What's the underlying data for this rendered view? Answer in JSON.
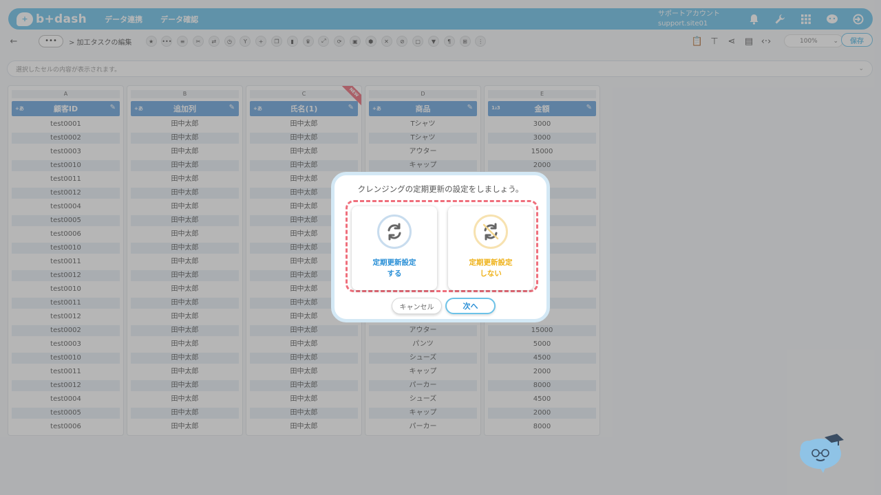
{
  "nav": {
    "logo_text": "b+dash",
    "links": [
      "データ連携",
      "データ確認"
    ],
    "account_line1": "サポートアカウント",
    "account_line2": "support.site01"
  },
  "toolbar": {
    "more_label": "•••",
    "breadcrumb": "> 加工タスクの編集",
    "zoom": "100%",
    "save_label": "保存"
  },
  "formula_bar": {
    "text": "選択したセルの内容が表示されます。"
  },
  "grid": {
    "columns": [
      {
        "letter": "A",
        "type": "+あ",
        "name": "顧客ID",
        "is_new": false
      },
      {
        "letter": "B",
        "type": "+あ",
        "name": "追加列",
        "is_new": false
      },
      {
        "letter": "C",
        "type": "+あ",
        "name": "氏名(1)",
        "is_new": true,
        "badge": "NEW"
      },
      {
        "letter": "D",
        "type": "+あ",
        "name": "商品",
        "is_new": false
      },
      {
        "letter": "E",
        "type": "1₂3",
        "name": "金額",
        "is_new": false
      }
    ],
    "col_a": [
      "test0001",
      "test0002",
      "test0003",
      "test0010",
      "test0011",
      "test0012",
      "test0004",
      "test0005",
      "test0006",
      "test0010",
      "test0011",
      "test0012",
      "test0010",
      "test0011",
      "test0012",
      "test0002",
      "test0003",
      "test0010",
      "test0011",
      "test0012",
      "test0004",
      "test0005",
      "test0006"
    ],
    "col_b": [
      "田中太郎",
      "田中太郎",
      "田中太郎",
      "田中太郎",
      "田中太郎",
      "田中太郎",
      "田中太郎",
      "田中太郎",
      "田中太郎",
      "田中太郎",
      "田中太郎",
      "田中太郎",
      "田中太郎",
      "田中太郎",
      "田中太郎",
      "田中太郎",
      "田中太郎",
      "田中太郎",
      "田中太郎",
      "田中太郎",
      "田中太郎",
      "田中太郎",
      "田中太郎"
    ],
    "col_c": [
      "田中太郎",
      "田中太郎",
      "田中太郎",
      "田中太郎",
      "田中太郎",
      "田中太郎",
      "田中太郎",
      "田中太郎",
      "田中太郎",
      "田中太郎",
      "田中太郎",
      "田中太郎",
      "田中太郎",
      "田中太郎",
      "田中太郎",
      "田中太郎",
      "田中太郎",
      "田中太郎",
      "田中太郎",
      "田中太郎",
      "田中太郎",
      "田中太郎",
      "田中太郎"
    ],
    "col_d": [
      "Tシャツ",
      "Tシャツ",
      "アウター",
      "キャップ",
      "",
      "",
      "",
      "",
      "",
      "",
      "",
      "",
      "",
      "",
      "",
      "アウター",
      "パンツ",
      "シューズ",
      "キャップ",
      "パーカー",
      "シューズ",
      "キャップ",
      "パーカー"
    ],
    "col_e": [
      "3000",
      "3000",
      "15000",
      "2000",
      "",
      "",
      "",
      "",
      "",
      "",
      "",
      "",
      "",
      "",
      "",
      "15000",
      "5000",
      "4500",
      "2000",
      "8000",
      "4500",
      "2000",
      "8000"
    ]
  },
  "modal": {
    "title": "クレンジングの定期更新の設定をしましょう。",
    "option_yes_line1": "定期更新設定",
    "option_yes_line2": "する",
    "option_no_line1": "定期更新設定",
    "option_no_line2": "しない",
    "cancel_label": "キャンセル",
    "next_label": "次へ"
  }
}
